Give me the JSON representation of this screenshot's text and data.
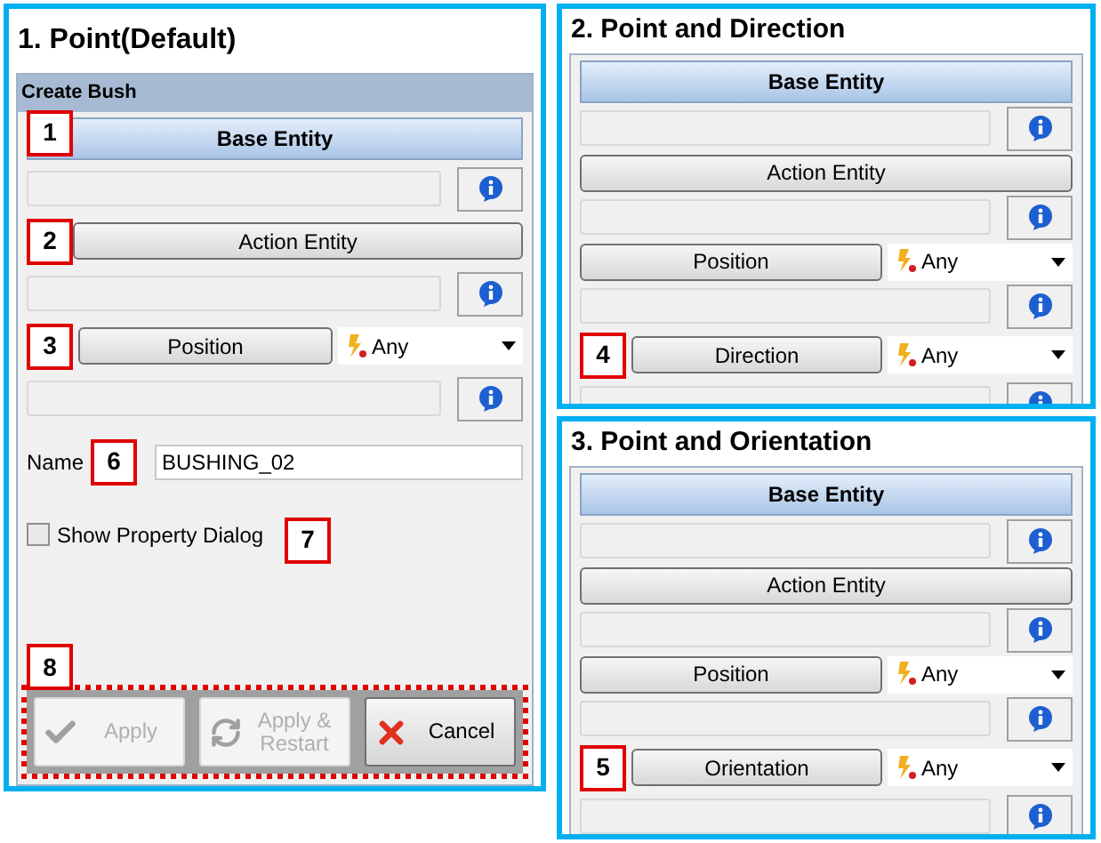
{
  "panels": [
    {
      "title": "1. Point(Default)",
      "dialog_title": "Create Bush",
      "rows": [
        {
          "kind": "header",
          "label": "Base Entity",
          "marker": "1"
        },
        {
          "kind": "field"
        },
        {
          "kind": "button",
          "label": "Action Entity",
          "marker": "2"
        },
        {
          "kind": "field"
        },
        {
          "kind": "select",
          "label": "Position",
          "value": "Any",
          "marker": "3"
        },
        {
          "kind": "field"
        },
        {
          "kind": "name",
          "label": "Name",
          "value": "BUSHING_02",
          "marker": "6"
        },
        {
          "kind": "checkbox",
          "label": "Show Property Dialog",
          "checked": false,
          "marker": "7"
        },
        {
          "kind": "actions",
          "marker": "8",
          "buttons": [
            {
              "label": "Apply",
              "disabled": true
            },
            {
              "label": "Apply & Restart",
              "disabled": true
            },
            {
              "label": "Cancel",
              "disabled": false
            }
          ]
        }
      ]
    },
    {
      "title": "2. Point and Direction",
      "rows": [
        {
          "kind": "header",
          "label": "Base Entity"
        },
        {
          "kind": "field"
        },
        {
          "kind": "button",
          "label": "Action Entity"
        },
        {
          "kind": "field"
        },
        {
          "kind": "select",
          "label": "Position",
          "value": "Any"
        },
        {
          "kind": "field"
        },
        {
          "kind": "select",
          "label": "Direction",
          "value": "Any",
          "marker": "4"
        },
        {
          "kind": "field"
        }
      ]
    },
    {
      "title": "3. Point and Orientation",
      "rows": [
        {
          "kind": "header",
          "label": "Base Entity"
        },
        {
          "kind": "field"
        },
        {
          "kind": "button",
          "label": "Action Entity"
        },
        {
          "kind": "field"
        },
        {
          "kind": "select",
          "label": "Position",
          "value": "Any"
        },
        {
          "kind": "field"
        },
        {
          "kind": "select",
          "label": "Orientation",
          "value": "Any",
          "marker": "5"
        },
        {
          "kind": "field"
        }
      ]
    }
  ]
}
